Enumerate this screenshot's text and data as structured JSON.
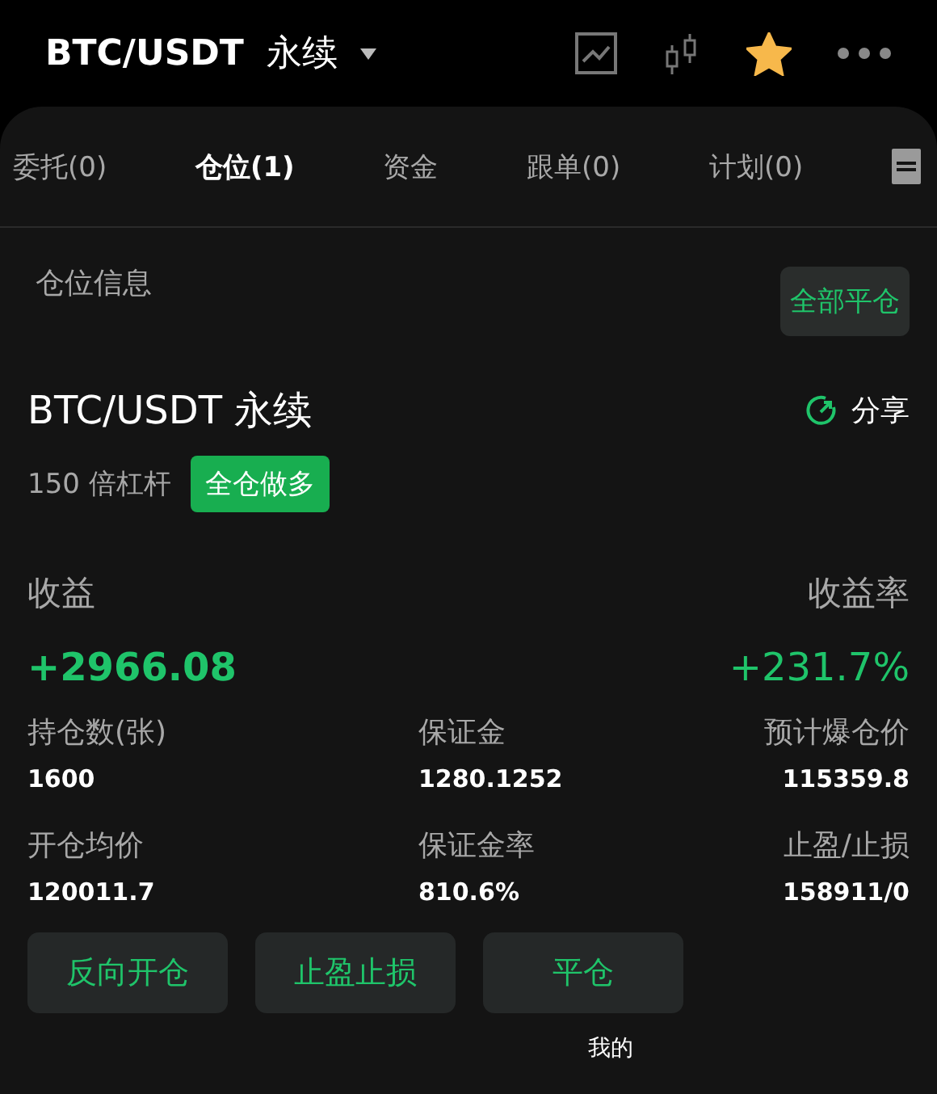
{
  "header": {
    "title": "BTC/USDT",
    "subtitle": "永续",
    "starred": true
  },
  "tabs": [
    {
      "label": "委托(0)",
      "selected": false
    },
    {
      "label": "仓位(1)",
      "selected": true
    },
    {
      "label": "资金",
      "selected": false
    },
    {
      "label": "跟单(0)",
      "selected": false
    },
    {
      "label": "计划(0)",
      "selected": false
    }
  ],
  "section": {
    "title": "仓位信息",
    "close_all": "全部平仓"
  },
  "position": {
    "name": "BTC/USDT 永续",
    "share": "分享",
    "leverage": "150 倍杠杆",
    "mode": "全仓做多",
    "pnl_label": "收益",
    "pnl": "+2966.08",
    "roe_label": "收益率",
    "roe": "+231.7%",
    "stats": [
      {
        "label": "持仓数(张)",
        "value": "1600"
      },
      {
        "label": "保证金",
        "value": "1280.1252"
      },
      {
        "label": "预计爆仓价",
        "value": "115359.8"
      },
      {
        "label": "开仓均价",
        "value": "120011.7"
      },
      {
        "label": "保证金率",
        "value": "810.6%"
      },
      {
        "label": "止盈/止损",
        "value": "158911/0"
      }
    ]
  },
  "actions": [
    "反向开仓",
    "止盈止损",
    "平仓"
  ],
  "caption": "我的"
}
